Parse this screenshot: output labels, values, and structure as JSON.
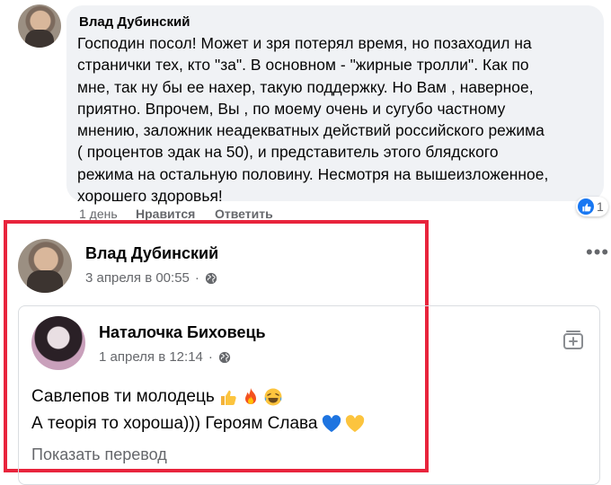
{
  "comment": {
    "author": "Влад Дубинский",
    "text": "Господин посол! Может и зря потерял время, но позаходил на\nстранички тех, кто \"за\". В основном - \"жирные тролли\". Как по\nмне, так ну бы ее нахер, такую поддержку. Но Вам , наверное,\nприятно. Впрочем, Вы , по моему очень и сугубо частному\nмнению, заложник неадекватных действий российского режима\n( процентов эдак на 50), и представитель этого блядского\nрежима на остальную половину. Несмотря на вышеизложенное,\nхорошего здоровья!",
    "time": "1 день",
    "like_label": "Нравится",
    "reply_label": "Ответить",
    "reaction_count": "1"
  },
  "post": {
    "author": "Влад Дубинский",
    "time": "3 апреля в 00:55",
    "separator": "·",
    "more": "•••"
  },
  "shared": {
    "author": "Наталочка Биховець",
    "time": "1 апреля в 12:14",
    "separator": "·",
    "line1": "Савлепов ти молодець",
    "line2": "А теорія то хороша))) Героям Слава",
    "translate_label": "Показать перевод"
  },
  "colors": {
    "highlight": "#e8243c",
    "like_blue": "#1877f2",
    "bubble_bg": "#f0f2f5",
    "secondary_text": "#65676b"
  }
}
